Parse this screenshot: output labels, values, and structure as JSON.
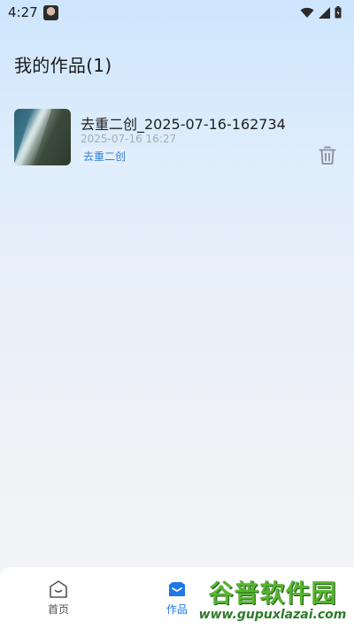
{
  "status_bar": {
    "time": "4:27",
    "icons": [
      "wifi-icon",
      "signal-icon",
      "battery-icon"
    ]
  },
  "page": {
    "title": "我的作品(1)"
  },
  "works": [
    {
      "title": "去重二创_2025-07-16-162734",
      "date": "2025-07-16 16:27",
      "tag": "去重二创",
      "thumbnail_icon": "coastline-thumbnail"
    }
  ],
  "bottom_nav": {
    "items": [
      {
        "label": "首页",
        "icon": "home-icon",
        "active": false
      },
      {
        "label": "作品",
        "icon": "works-icon",
        "active": true
      }
    ],
    "active_color": "#1e78e6"
  },
  "watermark": {
    "text": "谷普软件园",
    "url": "www.gupuxlazai.com"
  },
  "colors": {
    "accent": "#1e78e6",
    "tag_text": "#2f7fdc",
    "tag_bg": "#e3effc",
    "watermark_green": "#59b530"
  }
}
